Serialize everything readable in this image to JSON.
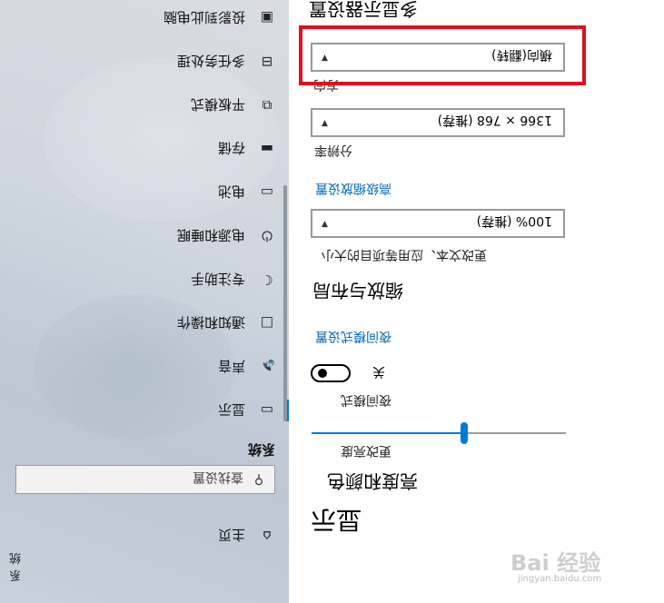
{
  "nav": {
    "home_label": "主页",
    "search_placeholder": "查找设置",
    "section_label": "系统",
    "items": [
      {
        "label": "显示",
        "icon": "monitor-icon"
      },
      {
        "label": "声音",
        "icon": "speaker-icon"
      },
      {
        "label": "通知和操作",
        "icon": "notification-icon"
      },
      {
        "label": "专注助手",
        "icon": "moon-icon"
      },
      {
        "label": "电源和睡眠",
        "icon": "power-icon"
      },
      {
        "label": "电池",
        "icon": "battery-icon"
      },
      {
        "label": "存储",
        "icon": "storage-icon"
      },
      {
        "label": "平板模式",
        "icon": "tablet-icon"
      },
      {
        "label": "多任务处理",
        "icon": "multitask-icon"
      },
      {
        "label": "投影到此电脑",
        "icon": "project-icon"
      }
    ],
    "footer_label": "系统"
  },
  "main": {
    "title": "显示",
    "brightness_heading": "亮度和颜色",
    "brightness_label": "更改亮度",
    "brightness_percent": 60,
    "night_light_label": "夜间模式",
    "night_light_state": "关",
    "night_light_link": "夜间模式设置",
    "scale_heading": "缩放与布局",
    "scale_label": "更改文本、应用等项目的大小",
    "scale_value": "100% (推荐)",
    "advanced_scaling_link": "高级缩放设置",
    "resolution_label": "分辨率",
    "resolution_value": "1366 × 768 (推荐)",
    "orientation_label": "方向",
    "orientation_value": "横向(翻转)",
    "multi_display_heading": "多显示器设置"
  },
  "colors": {
    "accent": "#0078d7",
    "highlight": "#e0101c"
  },
  "watermark": {
    "brand": "Bai 经验",
    "url": "jingyan.baidu.com"
  }
}
